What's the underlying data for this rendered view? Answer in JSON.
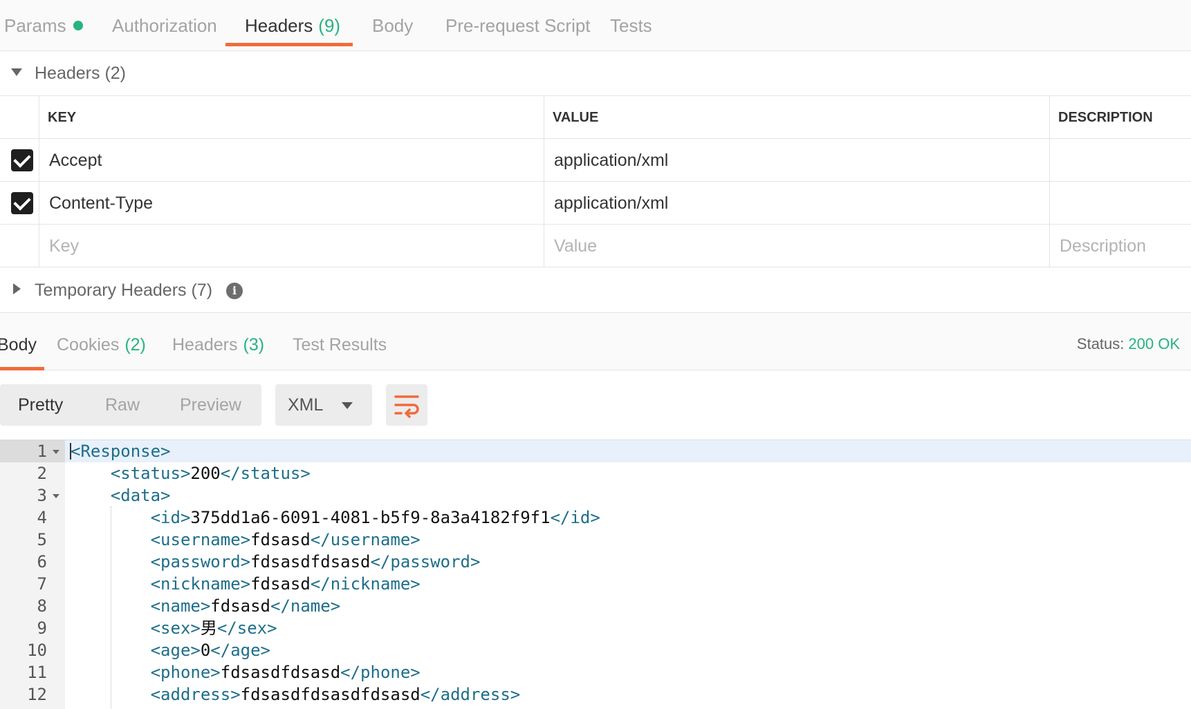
{
  "request_tabs": [
    {
      "label": "Params",
      "count": null
    },
    {
      "label": "Authorization",
      "count": null
    },
    {
      "label": "Headers",
      "count": "(9)"
    },
    {
      "label": "Body",
      "count": null
    },
    {
      "label": "Pre-request Script",
      "count": null
    },
    {
      "label": "Tests",
      "count": null
    }
  ],
  "headers_section": {
    "title": "Headers",
    "count": "(2)",
    "columns": {
      "key": "KEY",
      "value": "VALUE",
      "description": "DESCRIPTION"
    },
    "rows": [
      {
        "checked": true,
        "key": "Accept",
        "value": "application/xml",
        "description": ""
      },
      {
        "checked": true,
        "key": "Content-Type",
        "value": "application/xml",
        "description": ""
      }
    ],
    "placeholders": {
      "key": "Key",
      "value": "Value",
      "description": "Description"
    }
  },
  "temporary_headers": {
    "title": "Temporary Headers",
    "count": "(7)",
    "info_icon": "i"
  },
  "response_tabs": [
    {
      "label": "Body",
      "count": null
    },
    {
      "label": "Cookies",
      "count": "(2)"
    },
    {
      "label": "Headers",
      "count": "(3)"
    },
    {
      "label": "Test Results",
      "count": null
    }
  ],
  "status": {
    "label": "Status:",
    "value": "200 OK"
  },
  "view_modes": [
    "Pretty",
    "Raw",
    "Preview"
  ],
  "format": {
    "selected": "XML"
  },
  "code_lines": [
    {
      "n": "1",
      "open": "<Response>",
      "text": "",
      "close": ""
    },
    {
      "n": "2",
      "open": "<status>",
      "text": "200",
      "close": "</status>"
    },
    {
      "n": "3",
      "open": "<data>",
      "text": "",
      "close": ""
    },
    {
      "n": "4",
      "open": "<id>",
      "text": "375dd1a6-6091-4081-b5f9-8a3a4182f9f1",
      "close": "</id>"
    },
    {
      "n": "5",
      "open": "<username>",
      "text": "fdsasd",
      "close": "</username>"
    },
    {
      "n": "6",
      "open": "<password>",
      "text": "fdsasdfdsasd",
      "close": "</password>"
    },
    {
      "n": "7",
      "open": "<nickname>",
      "text": "fdsasd",
      "close": "</nickname>"
    },
    {
      "n": "8",
      "open": "<name>",
      "text": "fdsasd",
      "close": "</name>"
    },
    {
      "n": "9",
      "open": "<sex>",
      "text": "男",
      "close": "</sex>"
    },
    {
      "n": "10",
      "open": "<age>",
      "text": "0",
      "close": "</age>"
    },
    {
      "n": "11",
      "open": "<phone>",
      "text": "fdsasdfdsasd",
      "close": "</phone>"
    },
    {
      "n": "12",
      "open": "<address>",
      "text": "fdsasdfdsasdfdsasd",
      "close": "</address>"
    }
  ],
  "colors": {
    "accent": "#f26b3a",
    "success": "#26b47f",
    "xml_tag": "#1d6e8a"
  }
}
